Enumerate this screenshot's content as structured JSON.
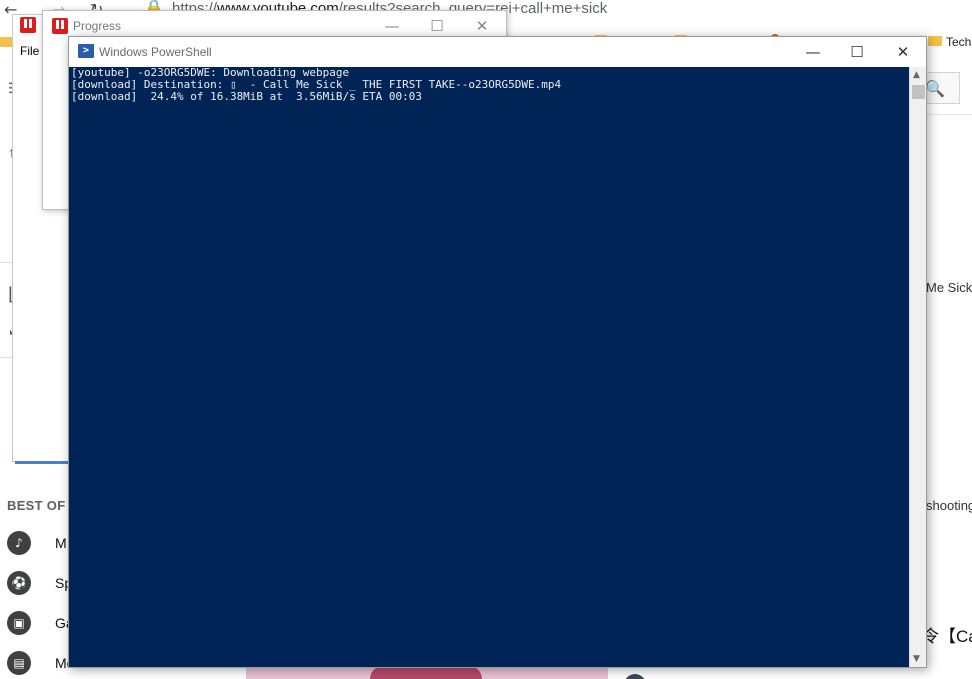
{
  "browser": {
    "back_glyph": "←",
    "forward_glyph": "→",
    "reload_glyph": "↻",
    "url_prefix": "https://",
    "url_host": "www.youtube.com",
    "url_path": "/results?search_query=rei+call+me+sick",
    "bookmarks": {
      "tech_label": "Tech"
    }
  },
  "youtube": {
    "sidebar_heading": "BEST OF Y",
    "sidebar_items": [
      {
        "icon": "music-icon",
        "glyph": "♪",
        "label": "M"
      },
      {
        "icon": "sports-icon",
        "glyph": "⚽",
        "label": "Sp"
      },
      {
        "icon": "gaming-icon",
        "glyph": "▣",
        "label": "Ga"
      },
      {
        "icon": "movies-icon",
        "glyph": "▤",
        "label": "Movies & Shows"
      }
    ],
    "right_snippet_1": "Me Sick",
    "right_snippet_2": "shooting",
    "right_title": "令【Ca"
  },
  "progress_back": {
    "file_menu": "File"
  },
  "progress": {
    "title": "Progress",
    "minimize": "—",
    "maximize": "☐",
    "close": "✕"
  },
  "powershell": {
    "title": "Windows PowerShell",
    "minimize": "—",
    "maximize": "☐",
    "close": "✕",
    "lines": [
      "[youtube] -o23ORG5DWE: Downloading webpage",
      "[download] Destination: ▯  - Call Me Sick _ THE FIRST TAKE--o23ORG5DWE.mp4",
      "[download]  24.4% of 16.38MiB at  3.56MiB/s ETA 00:03"
    ],
    "scroll_up": "▲",
    "scroll_down": "▼"
  },
  "colors": {
    "console_bg": "#012456",
    "console_fg": "#eeedf0",
    "app_red": "#d81e1e",
    "folder_yellow": "#f4c24a"
  }
}
